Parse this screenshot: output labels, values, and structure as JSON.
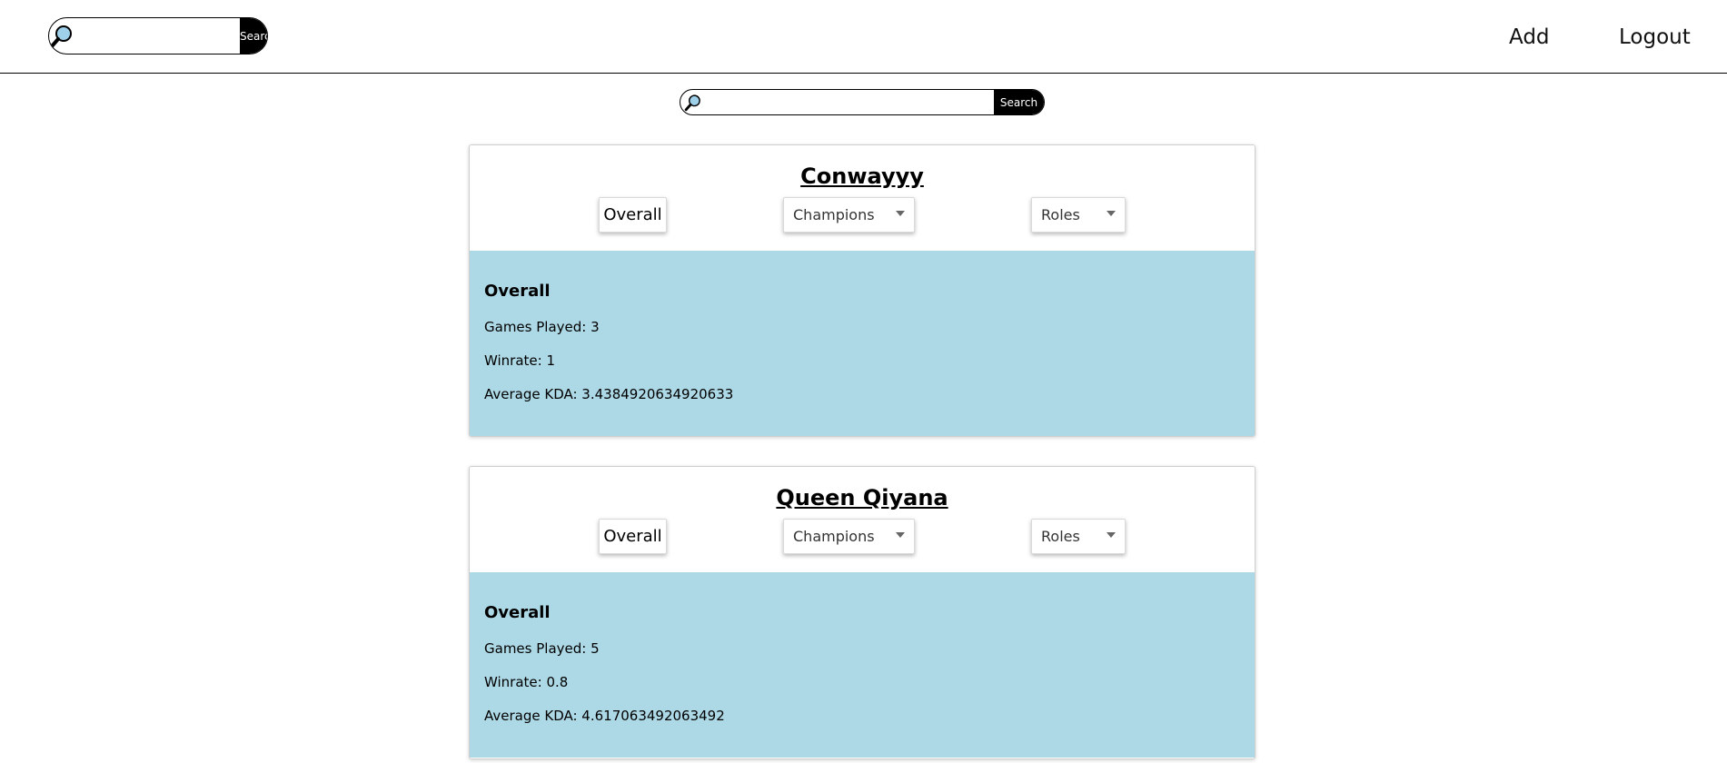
{
  "navbar": {
    "search": {
      "placeholder": "",
      "value": "",
      "button_label": "Search"
    },
    "links": {
      "add": "Add",
      "logout": "Logout"
    }
  },
  "main_search": {
    "placeholder": "",
    "value": "",
    "button_label": "Search"
  },
  "players": [
    {
      "name": "Conwayyy",
      "overall_button": "Overall",
      "champions_dropdown": "Champions",
      "roles_dropdown": "Roles",
      "stats_heading": "Overall",
      "games_played": "Games Played: 3",
      "winrate": "Winrate: 1",
      "average_kda": "Average KDA: 3.4384920634920633"
    },
    {
      "name": "Queen Qiyana",
      "overall_button": "Overall",
      "champions_dropdown": "Champions",
      "roles_dropdown": "Roles",
      "stats_heading": "Overall",
      "games_played": "Games Played: 5",
      "winrate": "Winrate: 0.8",
      "average_kda": "Average KDA: 4.617063492063492"
    }
  ],
  "colors": {
    "stats_background": "#add8e6",
    "search_button": "#000000"
  }
}
